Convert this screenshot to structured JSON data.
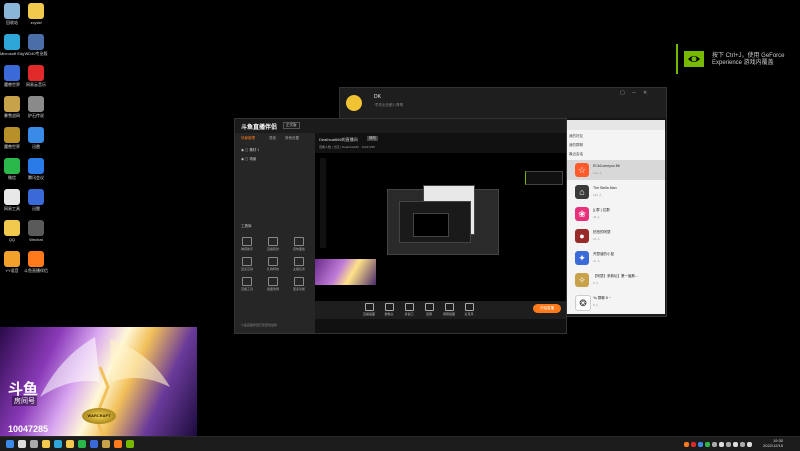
{
  "desktop": {
    "icons": [
      {
        "label": "回收站",
        "color": "#8ab4d8"
      },
      {
        "label": "zxyxkf",
        "color": "#f2c94c"
      },
      {
        "label": "Microsoft Edge",
        "color": "#2fa6d8"
      },
      {
        "label": "WD40专业版",
        "color": "#4a6ea8"
      },
      {
        "label": "魔兽世界",
        "color": "#3a6ad8"
      },
      {
        "label": "网易云音乐",
        "color": "#e02a2a"
      },
      {
        "label": "暴雪战网",
        "color": "#c8a24a"
      },
      {
        "label": "炉石传说",
        "color": "#8a8a8a"
      },
      {
        "label": "魔兽世界",
        "color": "#b8902a"
      },
      {
        "label": "迅雷",
        "color": "#3a8ae8"
      },
      {
        "label": "微信",
        "color": "#2ab84a"
      },
      {
        "label": "腾讯会议",
        "color": "#2a7ae8"
      },
      {
        "label": "网易工具",
        "color": "#e8e8e8"
      },
      {
        "label": "迅雷",
        "color": "#3a6ad8"
      },
      {
        "label": "QQ",
        "color": "#f2c94c"
      },
      {
        "label": "Wechat",
        "color": "#5a5a5a"
      },
      {
        "label": "YY语音",
        "color": "#f2a22a"
      },
      {
        "label": "斗鱼直播伴侣",
        "color": "#ff7a1a"
      }
    ]
  },
  "nvidia_toast": {
    "line1": "按下 Ctrl+J，使用 GeForce",
    "line2": "Experience 游戏内覆盖"
  },
  "qq_window": {
    "name": "DK",
    "desc": "·早先出去都八哥哥",
    "controls": "▢ ─ ✕",
    "contacts": {
      "categories": [
        "我的好友",
        "我的群聊",
        "最近会话"
      ],
      "items": [
        {
          "name": "ECbComeyou 8K",
          "sub": "132 人",
          "color": "#ff5a2a",
          "glyph": "☆"
        },
        {
          "name": "The Stella Man",
          "sub": "132 人",
          "color": "#3a3a3a",
          "glyph": "⌂"
        },
        {
          "name": "(( 群 ) 拉群",
          "sub": "46 人",
          "color": "#e8307a",
          "glyph": "❀"
        },
        {
          "name": "拍拍的阿瑟",
          "sub": "18 人",
          "color": "#9a2a2a",
          "glyph": "●"
        },
        {
          "name": "齐瑟诞的小鼠",
          "sub": "21 人",
          "color": "#3a6ad8",
          "glyph": "✦"
        },
        {
          "name": "【阿瑟】来新坛】第一届斯...",
          "sub": "5 人",
          "color": "#c8a24a",
          "glyph": "✧"
        },
        {
          "name": "Yo 群聊 8 ~",
          "sub": "8 人",
          "color": "#ffffff",
          "glyph": "❂"
        }
      ]
    }
  },
  "stream_app": {
    "logo": "斗鱼直播伴侣",
    "badge": "正式版",
    "tabs": [
      "场景管理",
      "混音",
      "其他设置"
    ],
    "scenes": [
      "素材 1",
      "场景"
    ],
    "room_title": "Deathcat666的直播间",
    "room_button": "修改",
    "line2": "观看人数 | 分区 | Deathcat666 · 10047285",
    "tools_title": "工具库",
    "tools": [
      "弹幕助手",
      "直播装扮",
      "音效面板",
      "连麦互动",
      "礼物特效",
      "主播任务",
      "直播工具",
      "截图录屏",
      "更多功能"
    ],
    "bottom_buttons": [
      "直播画面",
      "摄像头",
      "多窗口",
      "连屏",
      "屏幕截图",
      "麦克风"
    ],
    "start_live": "开始直播",
    "footer": "斗鱼直播伴侣已安装到最新"
  },
  "douyu_overlay": {
    "logo": "斗鱼",
    "label": "房间号",
    "room_number": "10047285",
    "wow": "WARCRAFT"
  },
  "taskbar": {
    "icons": [
      {
        "name": "windows-start-icon",
        "color": "#3a8ae8"
      },
      {
        "name": "search-icon",
        "color": "#dddddd"
      },
      {
        "name": "task-view-icon",
        "color": "#aaaaaa"
      },
      {
        "name": "file-explorer-icon",
        "color": "#f2c94c"
      },
      {
        "name": "edge-icon",
        "color": "#2fa6d8"
      },
      {
        "name": "qq-icon",
        "color": "#f2c94c"
      },
      {
        "name": "wechat-icon",
        "color": "#2ab84a"
      },
      {
        "name": "wow-icon",
        "color": "#3a6ad8"
      },
      {
        "name": "battlenet-icon",
        "color": "#c8a24a"
      },
      {
        "name": "douyu-icon",
        "color": "#ff7a1a"
      },
      {
        "name": "nvidia-icon",
        "color": "#76b900"
      }
    ],
    "time": "19:30",
    "date": "2022/12/15"
  }
}
